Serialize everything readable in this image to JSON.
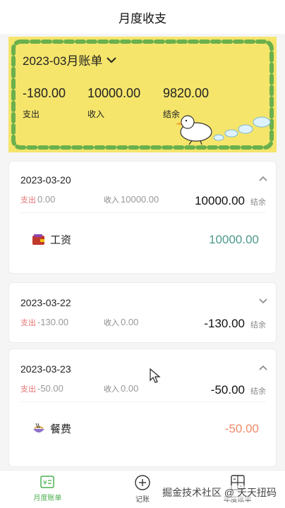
{
  "header": {
    "title": "月度收支"
  },
  "banner": {
    "month_label": "2023-03月账单",
    "expense": {
      "value": "-180.00",
      "label": "支出"
    },
    "income": {
      "value": "10000.00",
      "label": "收入"
    },
    "balance": {
      "value": "9820.00",
      "label": "结余"
    },
    "colors": {
      "background": "#f5e56b",
      "dash": "#6ab04c"
    }
  },
  "days": [
    {
      "date": "2023-03-20",
      "expanded": true,
      "expense_key": "支出",
      "expense": "0.00",
      "income_key": "收入",
      "income": "10000.00",
      "balance": "10000.00",
      "balance_key": "结余",
      "items": [
        {
          "icon": "wallet-icon",
          "name": "工资",
          "amount": "10000.00",
          "color": "#4e9a8a"
        }
      ]
    },
    {
      "date": "2023-03-22",
      "expanded": false,
      "expense_key": "支出",
      "expense": "-130.00",
      "income_key": "收入",
      "income": "0.00",
      "balance": "-130.00",
      "balance_key": "结余",
      "items": []
    },
    {
      "date": "2023-03-23",
      "expanded": true,
      "expense_key": "支出",
      "expense": "-50.00",
      "income_key": "收入",
      "income": "0.00",
      "balance": "-50.00",
      "balance_key": "结余",
      "items": [
        {
          "icon": "food-bowl-icon",
          "name": "餐费",
          "amount": "-50.00",
          "color": "#f08a6a"
        }
      ]
    }
  ],
  "tabbar": {
    "tabs": [
      {
        "label": "月度账单",
        "icon": "bill-icon",
        "active": true
      },
      {
        "label": "记账",
        "icon": "plus-circle-icon",
        "active": false
      },
      {
        "label": "年度账单",
        "icon": "calculator-icon",
        "active": false
      }
    ]
  },
  "watermark": "掘金技术社区 @ 天天扭码"
}
